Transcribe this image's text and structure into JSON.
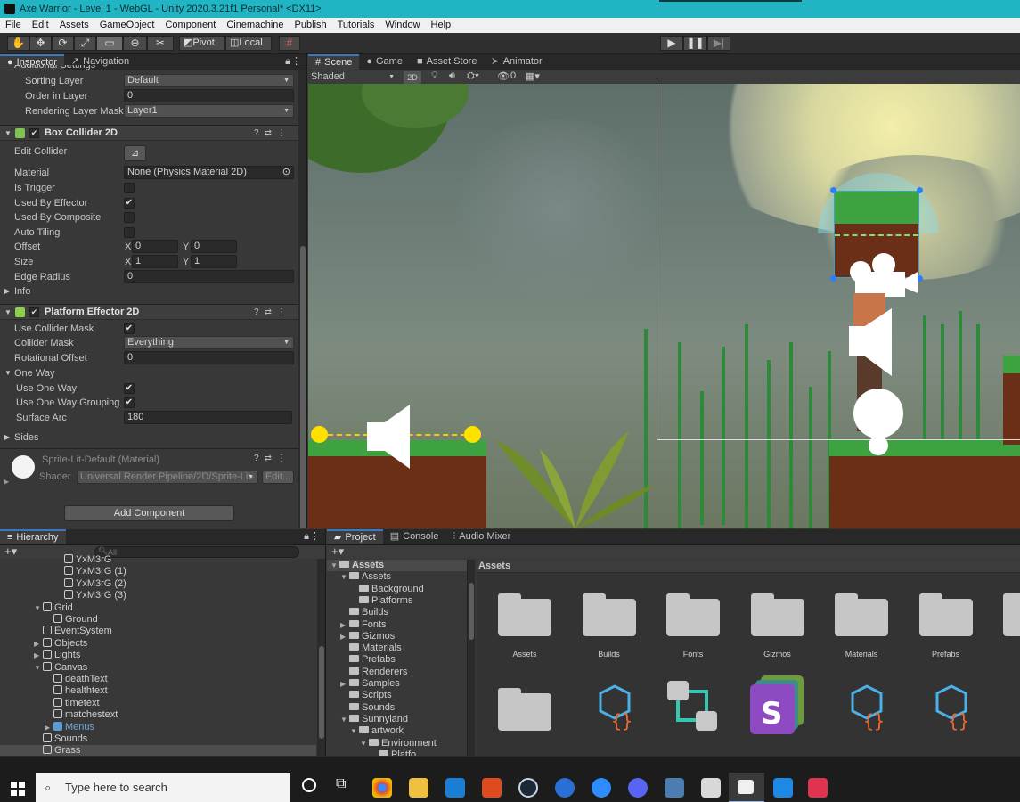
{
  "window": {
    "title": "Axe Warrior - Level 1 - WebGL - Unity 2020.3.21f1 Personal* <DX11>"
  },
  "menu": [
    "File",
    "Edit",
    "Assets",
    "GameObject",
    "Component",
    "Cinemachine",
    "Publish",
    "Tutorials",
    "Window",
    "Help"
  ],
  "toolbar": {
    "pivot_label": "Pivot",
    "local_label": "Local"
  },
  "inspector": {
    "tabs": [
      "Inspector",
      "Navigation"
    ],
    "additional_settings": "Additional Settings",
    "sorting_layer_label": "Sorting Layer",
    "sorting_layer_value": "Default",
    "order_label": "Order in Layer",
    "order_value": "0",
    "rendering_mask_label": "Rendering Layer Mask",
    "rendering_mask_value": "Layer1",
    "box_collider": {
      "title": "Box Collider 2D",
      "edit_collider": "Edit Collider",
      "material_label": "Material",
      "material_value": "None (Physics Material 2D)",
      "is_trigger": "Is Trigger",
      "used_by_effector": "Used By Effector",
      "used_by_composite": "Used By Composite",
      "auto_tiling": "Auto Tiling",
      "offset_label": "Offset",
      "offset_x": "0",
      "offset_y": "0",
      "size_label": "Size",
      "size_x": "1",
      "size_y": "1",
      "edge_radius_label": "Edge Radius",
      "edge_radius_value": "0",
      "info": "Info",
      "x": "X",
      "y": "Y"
    },
    "platform_effector": {
      "title": "Platform Effector 2D",
      "use_collider_mask": "Use Collider Mask",
      "collider_mask_label": "Collider Mask",
      "collider_mask_value": "Everything",
      "rotational_offset_label": "Rotational Offset",
      "rotational_offset_value": "0",
      "one_way": "One Way",
      "use_one_way": "Use One Way",
      "use_one_way_grouping": "Use One Way Grouping",
      "surface_arc_label": "Surface Arc",
      "surface_arc_value": "180",
      "sides": "Sides"
    },
    "material": {
      "name": "Sprite-Lit-Default (Material)",
      "shader_label": "Shader",
      "shader_value": "Universal Render Pipeline/2D/Sprite-Lit-",
      "edit_label": "Edit..."
    },
    "add_component": "Add Component",
    "check": "✔"
  },
  "scene": {
    "tabs": [
      "Scene",
      "Game",
      "Asset Store",
      "Animator"
    ],
    "shading": "Shaded",
    "mode_2d": "2D",
    "hidden_count": "0"
  },
  "hierarchy": {
    "title": "Hierarchy",
    "search_placeholder": "All",
    "items": [
      {
        "label": "YxM3rG",
        "indent": 5
      },
      {
        "label": "YxM3rG (1)",
        "indent": 5
      },
      {
        "label": "YxM3rG (2)",
        "indent": 5
      },
      {
        "label": "YxM3rG (3)",
        "indent": 5
      },
      {
        "label": "Grid",
        "indent": 3,
        "fold": "▼"
      },
      {
        "label": "Ground",
        "indent": 4
      },
      {
        "label": "EventSystem",
        "indent": 3
      },
      {
        "label": "Objects",
        "indent": 3,
        "fold": "▶"
      },
      {
        "label": "Lights",
        "indent": 3,
        "fold": "▶"
      },
      {
        "label": "Canvas",
        "indent": 3,
        "fold": "▼"
      },
      {
        "label": "deathText",
        "indent": 4
      },
      {
        "label": "healthtext",
        "indent": 4
      },
      {
        "label": "timetext",
        "indent": 4
      },
      {
        "label": "matchestext",
        "indent": 4
      },
      {
        "label": "Menus",
        "indent": 4,
        "fold": "▶",
        "prefab": true
      },
      {
        "label": "Sounds",
        "indent": 3
      },
      {
        "label": "Grass",
        "indent": 3,
        "selected": true
      }
    ]
  },
  "project": {
    "tabs": [
      "Project",
      "Console",
      "Audio Mixer"
    ],
    "breadcrumb": "Assets",
    "tree": [
      {
        "label": "Assets",
        "indent": 0,
        "fold": "▼",
        "bold": true
      },
      {
        "label": "Assets",
        "indent": 1,
        "fold": "▼"
      },
      {
        "label": "Background",
        "indent": 2
      },
      {
        "label": "Platforms",
        "indent": 2
      },
      {
        "label": "Builds",
        "indent": 1
      },
      {
        "label": "Fonts",
        "indent": 1,
        "fold": "▶"
      },
      {
        "label": "Gizmos",
        "indent": 1,
        "fold": "▶"
      },
      {
        "label": "Materials",
        "indent": 1
      },
      {
        "label": "Prefabs",
        "indent": 1
      },
      {
        "label": "Renderers",
        "indent": 1
      },
      {
        "label": "Samples",
        "indent": 1,
        "fold": "▶"
      },
      {
        "label": "Scripts",
        "indent": 1
      },
      {
        "label": "Sounds",
        "indent": 1
      },
      {
        "label": "Sunnyland",
        "indent": 1,
        "fold": "▼"
      },
      {
        "label": "artwork",
        "indent": 2,
        "fold": "▼"
      },
      {
        "label": "Environment",
        "indent": 3,
        "fold": "▼"
      },
      {
        "label": "Platfo",
        "indent": 4
      }
    ],
    "assets_row1": [
      "Assets",
      "Builds",
      "Fonts",
      "Gizmos",
      "Materials",
      "Prefabs",
      "Re"
    ]
  },
  "taskbar": {
    "search_placeholder": "Type here to search"
  },
  "colors": {
    "accent": "#21b5c4",
    "selection": "#2c5d87",
    "scene_bg": "#6f7f78"
  }
}
